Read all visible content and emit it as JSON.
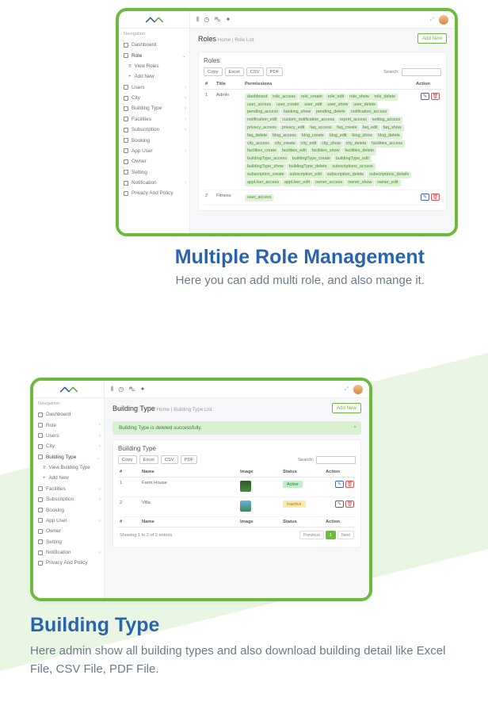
{
  "section1": {
    "title": "Multiple Role Management",
    "desc": "Here you can add multi role, and also mange it."
  },
  "section2": {
    "title": "Building Type",
    "desc": "Here admin show all building types and also download building detail like Excel File, CSV File, PDF File."
  },
  "common": {
    "nav_heading": "Navigation",
    "add_new_btn": "Add New",
    "export": {
      "copy": "Copy",
      "excel": "Excel",
      "csv": "CSV",
      "pdf": "PDF"
    },
    "search_label": "Search:",
    "col": {
      "hash": "#",
      "title": "Title",
      "permissions": "Permissions",
      "action": "Action",
      "name": "Name",
      "image": "Image",
      "status": "Status"
    },
    "breadcrumb_home": "Home"
  },
  "screen_roles": {
    "page_title": "Roles",
    "breadcrumb_tail": "Role List",
    "panel_title": "Roles",
    "nav": [
      "Dashboard",
      "Role",
      "View Roles",
      "Add New",
      "Users",
      "City",
      "Building Type",
      "Facilities",
      "Subscription",
      "Booking",
      "App User",
      "Owner",
      "Setting",
      "Notification",
      "Privacy And Policy"
    ],
    "rows": [
      {
        "idx": "1",
        "title": "Admin",
        "perms": [
          "dashboard",
          "role_access",
          "role_create",
          "role_edit",
          "role_show",
          "role_delete",
          "user_access",
          "user_create",
          "user_edit",
          "user_show",
          "user_delete",
          "pending_access",
          "banking_show",
          "pending_delete",
          "notification_access",
          "notification_edit",
          "custom_notification_access",
          "report_access",
          "setting_access",
          "privacy_access",
          "privacy_edit",
          "faq_access",
          "faq_create",
          "faq_edit",
          "faq_show",
          "faq_delete",
          "blog_access",
          "blog_create",
          "blog_edit",
          "blog_show",
          "blog_delete",
          "city_access",
          "city_create",
          "city_edit",
          "city_show",
          "city_delete",
          "facilities_access",
          "facilities_create",
          "facilities_edit",
          "facilities_show",
          "facilities_delete",
          "buildingType_access",
          "buildingType_create",
          "buildingType_edit",
          "buildingType_show",
          "buildingType_delete",
          "subscriptions_access",
          "subscription_create",
          "subscription_edit",
          "subscription_delete",
          "subscriptions_details",
          "appUser_access",
          "appUser_edit",
          "owner_access",
          "owner_show",
          "owner_edit"
        ]
      },
      {
        "idx": "2",
        "title": "Fitness",
        "perms": [
          "user_access"
        ]
      }
    ]
  },
  "screen_bt": {
    "page_title": "Building Type",
    "breadcrumb_tail": "Building Type List",
    "alert": "Building Type is deleted successfully.",
    "panel_title": "Building Type",
    "nav": [
      "Dashboard",
      "Role",
      "Users",
      "City",
      "Building Type",
      "View Building Type",
      "Add New",
      "Facilities",
      "Subscription",
      "Booking",
      "App User",
      "Owner",
      "Setting",
      "Notification",
      "Privacy And Policy"
    ],
    "rows": [
      {
        "idx": "1",
        "name": "Farm House",
        "status": "Active",
        "status_class": "b-act"
      },
      {
        "idx": "2",
        "name": "Villa",
        "status": "Inactive",
        "status_class": "b-in"
      }
    ],
    "footer_info": "Showing 1 to 2 of 2 entries",
    "pag": {
      "prev": "Previous",
      "cur": "1",
      "next": "Next"
    }
  }
}
